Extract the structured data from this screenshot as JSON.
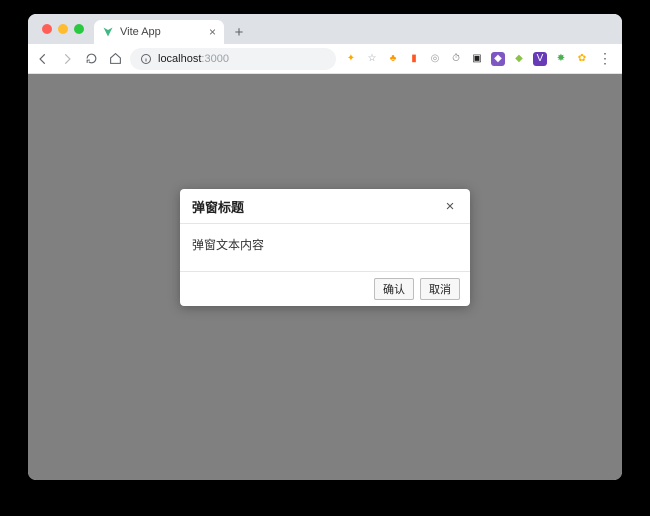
{
  "browser": {
    "tab_title": "Vite App",
    "url_host": "localhost",
    "url_port": ":3000",
    "icons": {
      "back": "back-icon",
      "forward": "forward-icon",
      "reload": "reload-icon",
      "home": "home-icon",
      "info": "info-icon",
      "new_tab": "+",
      "tab_close": "×",
      "menu": "⋮"
    },
    "extensions": [
      {
        "name": "gift-icon",
        "color": "#f9ab00",
        "glyph": "✦"
      },
      {
        "name": "star-icon",
        "color": "#bdbdbd",
        "glyph": "☆"
      },
      {
        "name": "orange-ext",
        "color": "#ff9800",
        "glyph": "♣"
      },
      {
        "name": "carrot-ext",
        "color": "#ff5722",
        "glyph": "▮"
      },
      {
        "name": "circle-ext",
        "color": "#9e9e9e",
        "glyph": "◎"
      },
      {
        "name": "stopwatch-ext",
        "color": "#757575",
        "glyph": "⏱"
      },
      {
        "name": "pocket-ext",
        "color": "#212121",
        "glyph": "▣"
      },
      {
        "name": "cube-ext",
        "color": "#7e57c2",
        "glyph": "◆"
      },
      {
        "name": "shield-ext",
        "color": "#8bc34a",
        "glyph": "◆"
      },
      {
        "name": "v-ext",
        "color": "#673ab7",
        "glyph": "V"
      },
      {
        "name": "badge-ext",
        "color": "#4caf50",
        "glyph": "✸"
      },
      {
        "name": "monkey-ext",
        "color": "#ffb300",
        "glyph": "✿"
      }
    ]
  },
  "dialog": {
    "title": "弹窗标题",
    "body": "弹窗文本内容",
    "close_label": "×",
    "confirm_label": "确认",
    "cancel_label": "取消"
  }
}
